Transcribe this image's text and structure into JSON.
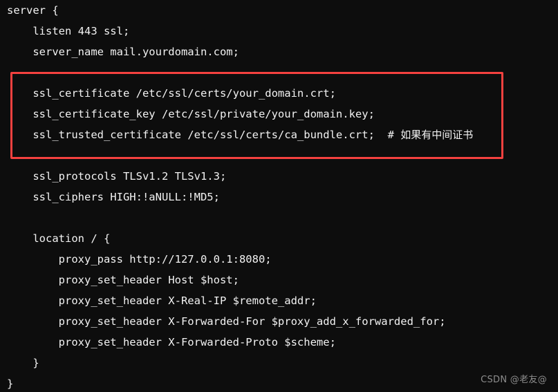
{
  "theme": {
    "background": "#0d0d0d",
    "text_color": "#f2f2f2",
    "highlight_border_color": "#f5413f",
    "watermark_color": "#8d8d8d"
  },
  "code": {
    "language": "nginx",
    "lines": [
      "server {",
      "    listen 443 ssl;",
      "    server_name mail.yourdomain.com;",
      "",
      "    ssl_certificate /etc/ssl/certs/your_domain.crt;",
      "    ssl_certificate_key /etc/ssl/private/your_domain.key;",
      "    ssl_trusted_certificate /etc/ssl/certs/ca_bundle.crt;  # 如果有中间证书",
      "",
      "    ssl_protocols TLSv1.2 TLSv1.3;",
      "    ssl_ciphers HIGH:!aNULL:!MD5;",
      "",
      "    location / {",
      "        proxy_pass http://127.0.0.1:8080;",
      "        proxy_set_header Host $host;",
      "        proxy_set_header X-Real-IP $remote_addr;",
      "        proxy_set_header X-Forwarded-For $proxy_add_x_forwarded_for;",
      "        proxy_set_header X-Forwarded-Proto $scheme;",
      "    }",
      "}"
    ]
  },
  "annotation": {
    "highlight_label": "ssl certificate directives highlight"
  },
  "watermark": {
    "text": "CSDN @老友@"
  }
}
